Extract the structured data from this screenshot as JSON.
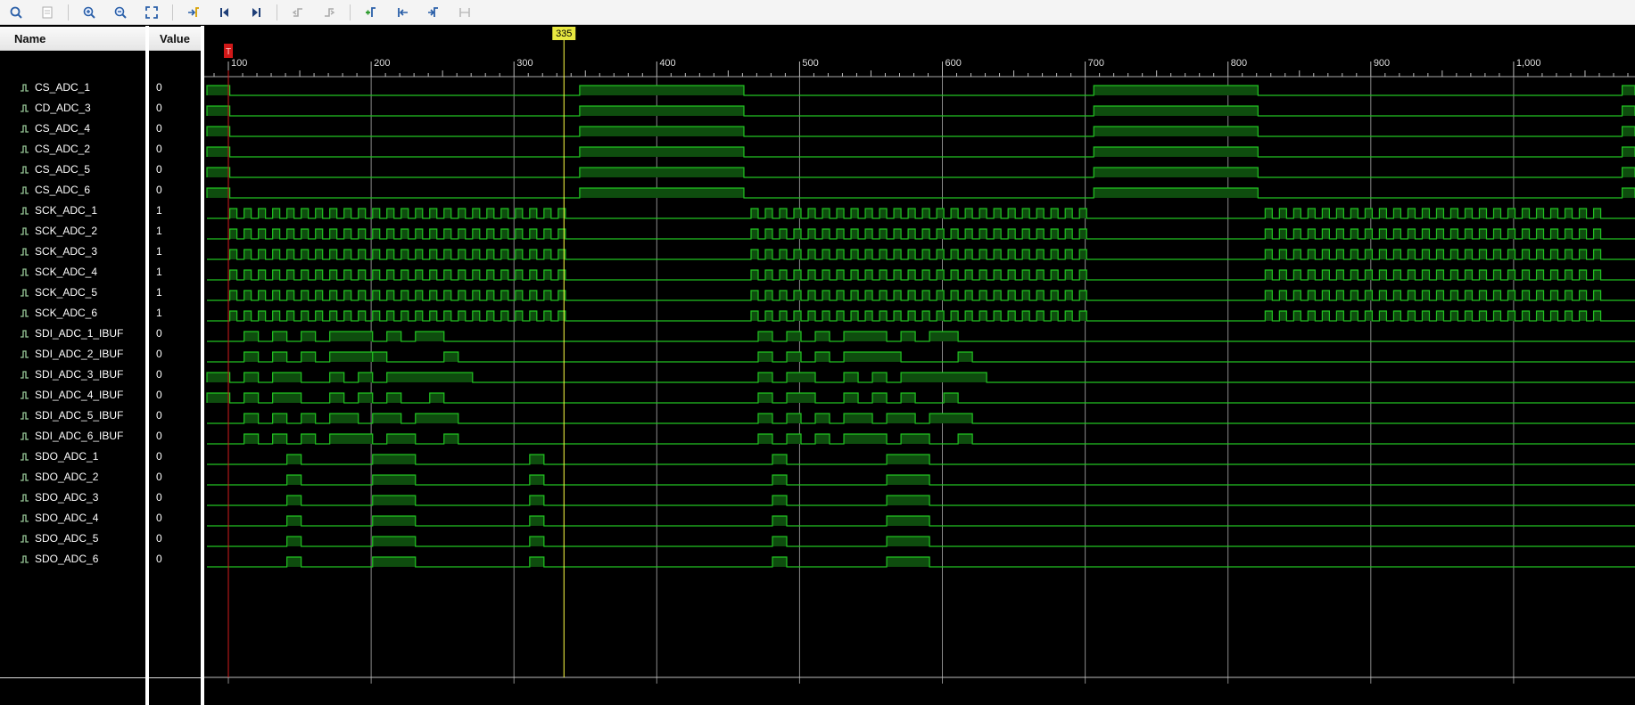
{
  "toolbar": {
    "buttons": [
      {
        "icon": "search-icon"
      },
      {
        "icon": "save-icon"
      },
      {
        "icon": "zoom-in-icon"
      },
      {
        "icon": "zoom-out-icon"
      },
      {
        "icon": "zoom-fit-icon"
      },
      {
        "icon": "go-to-cursor-icon"
      },
      {
        "icon": "go-to-start-icon"
      },
      {
        "icon": "go-to-end-icon"
      },
      {
        "icon": "previous-transition-icon"
      },
      {
        "icon": "next-transition-icon"
      },
      {
        "icon": "add-marker-icon"
      },
      {
        "icon": "previous-marker-icon"
      },
      {
        "icon": "next-marker-icon"
      },
      {
        "icon": "swap-cursors-icon"
      }
    ]
  },
  "columns": {
    "name": "Name",
    "value": "Value"
  },
  "colors": {
    "wave": "#22c322",
    "fill": "#0e4d0e",
    "grid": "#8a8a8a",
    "cursor": "#ffff44",
    "marker": "#d01818"
  },
  "cursor": {
    "time": 335,
    "label": "335"
  },
  "marker": {
    "time": 100,
    "label": "T"
  },
  "timeline": {
    "start": 85,
    "end": 1085,
    "ticks": [
      {
        "t": 100,
        "label": "100"
      },
      {
        "t": 200,
        "label": "200"
      },
      {
        "t": 300,
        "label": "300"
      },
      {
        "t": 400,
        "label": "400"
      },
      {
        "t": 500,
        "label": "500"
      },
      {
        "t": 600,
        "label": "600"
      },
      {
        "t": 700,
        "label": "700"
      },
      {
        "t": 800,
        "label": "800"
      },
      {
        "t": 900,
        "label": "900"
      },
      {
        "t": 1000,
        "label": "1,000"
      }
    ]
  },
  "signals": [
    {
      "name": "CS_ADC_1",
      "value": "0",
      "kind": "cs"
    },
    {
      "name": "CD_ADC_3",
      "value": "0",
      "kind": "cs"
    },
    {
      "name": "CS_ADC_4",
      "value": "0",
      "kind": "cs"
    },
    {
      "name": "CS_ADC_2",
      "value": "0",
      "kind": "cs"
    },
    {
      "name": "CS_ADC_5",
      "value": "0",
      "kind": "cs"
    },
    {
      "name": "CS_ADC_6",
      "value": "0",
      "kind": "cs"
    },
    {
      "name": "SCK_ADC_1",
      "value": "1",
      "kind": "sck"
    },
    {
      "name": "SCK_ADC_2",
      "value": "1",
      "kind": "sck"
    },
    {
      "name": "SCK_ADC_3",
      "value": "1",
      "kind": "sck"
    },
    {
      "name": "SCK_ADC_4",
      "value": "1",
      "kind": "sck"
    },
    {
      "name": "SCK_ADC_5",
      "value": "1",
      "kind": "sck"
    },
    {
      "name": "SCK_ADC_6",
      "value": "1",
      "kind": "sck"
    },
    {
      "name": "SDI_ADC_1_IBUF",
      "value": "0",
      "kind": "sdi",
      "pulses": [
        [
          111,
          121
        ],
        [
          131,
          141
        ],
        [
          151,
          161
        ],
        [
          171,
          201
        ],
        [
          211,
          221
        ],
        [
          231,
          251
        ],
        [
          471,
          481
        ],
        [
          491,
          501
        ],
        [
          511,
          521
        ],
        [
          531,
          561
        ],
        [
          571,
          581
        ],
        [
          591,
          611
        ]
      ]
    },
    {
      "name": "SDI_ADC_2_IBUF",
      "value": "0",
      "kind": "sdi",
      "pulses": [
        [
          111,
          121
        ],
        [
          131,
          141
        ],
        [
          151,
          161
        ],
        [
          171,
          201
        ],
        [
          201,
          211
        ],
        [
          251,
          261
        ],
        [
          471,
          481
        ],
        [
          491,
          501
        ],
        [
          511,
          521
        ],
        [
          531,
          571
        ],
        [
          611,
          621
        ]
      ]
    },
    {
      "name": "SDI_ADC_3_IBUF",
      "value": "0",
      "kind": "sdi",
      "pulses": [
        [
          85,
          101
        ],
        [
          111,
          121
        ],
        [
          131,
          151
        ],
        [
          171,
          181
        ],
        [
          191,
          201
        ],
        [
          211,
          271
        ],
        [
          471,
          481
        ],
        [
          491,
          511
        ],
        [
          531,
          541
        ],
        [
          551,
          561
        ],
        [
          571,
          631
        ]
      ]
    },
    {
      "name": "SDI_ADC_4_IBUF",
      "value": "0",
      "kind": "sdi",
      "pulses": [
        [
          85,
          101
        ],
        [
          111,
          121
        ],
        [
          131,
          151
        ],
        [
          171,
          181
        ],
        [
          191,
          201
        ],
        [
          211,
          221
        ],
        [
          241,
          251
        ],
        [
          471,
          481
        ],
        [
          491,
          511
        ],
        [
          531,
          541
        ],
        [
          551,
          561
        ],
        [
          571,
          581
        ],
        [
          601,
          611
        ]
      ]
    },
    {
      "name": "SDI_ADC_5_IBUF",
      "value": "0",
      "kind": "sdi",
      "pulses": [
        [
          111,
          121
        ],
        [
          131,
          141
        ],
        [
          151,
          161
        ],
        [
          171,
          191
        ],
        [
          201,
          221
        ],
        [
          231,
          261
        ],
        [
          471,
          481
        ],
        [
          491,
          501
        ],
        [
          511,
          521
        ],
        [
          531,
          551
        ],
        [
          561,
          581
        ],
        [
          591,
          621
        ]
      ]
    },
    {
      "name": "SDI_ADC_6_IBUF",
      "value": "0",
      "kind": "sdi",
      "pulses": [
        [
          111,
          121
        ],
        [
          131,
          141
        ],
        [
          151,
          161
        ],
        [
          171,
          201
        ],
        [
          211,
          231
        ],
        [
          251,
          261
        ],
        [
          471,
          481
        ],
        [
          491,
          501
        ],
        [
          511,
          521
        ],
        [
          531,
          561
        ],
        [
          571,
          591
        ],
        [
          611,
          621
        ]
      ]
    },
    {
      "name": "SDO_ADC_1",
      "value": "0",
      "kind": "sdo"
    },
    {
      "name": "SDO_ADC_2",
      "value": "0",
      "kind": "sdo"
    },
    {
      "name": "SDO_ADC_3",
      "value": "0",
      "kind": "sdo"
    },
    {
      "name": "SDO_ADC_4",
      "value": "0",
      "kind": "sdo"
    },
    {
      "name": "SDO_ADC_5",
      "value": "0",
      "kind": "sdo"
    },
    {
      "name": "SDO_ADC_6",
      "value": "0",
      "kind": "sdo"
    }
  ],
  "patterns": {
    "cs_high": [
      [
        85,
        101
      ],
      [
        346,
        461
      ],
      [
        706,
        821
      ],
      [
        1076,
        1085
      ]
    ],
    "sck_bursts": [
      [
        101,
        341
      ],
      [
        466,
        701
      ],
      [
        826,
        1061
      ]
    ],
    "sck_half": 5,
    "sdo_high": [
      [
        141,
        151
      ],
      [
        201,
        231
      ],
      [
        311,
        321
      ],
      [
        481,
        491
      ],
      [
        561,
        591
      ]
    ]
  }
}
